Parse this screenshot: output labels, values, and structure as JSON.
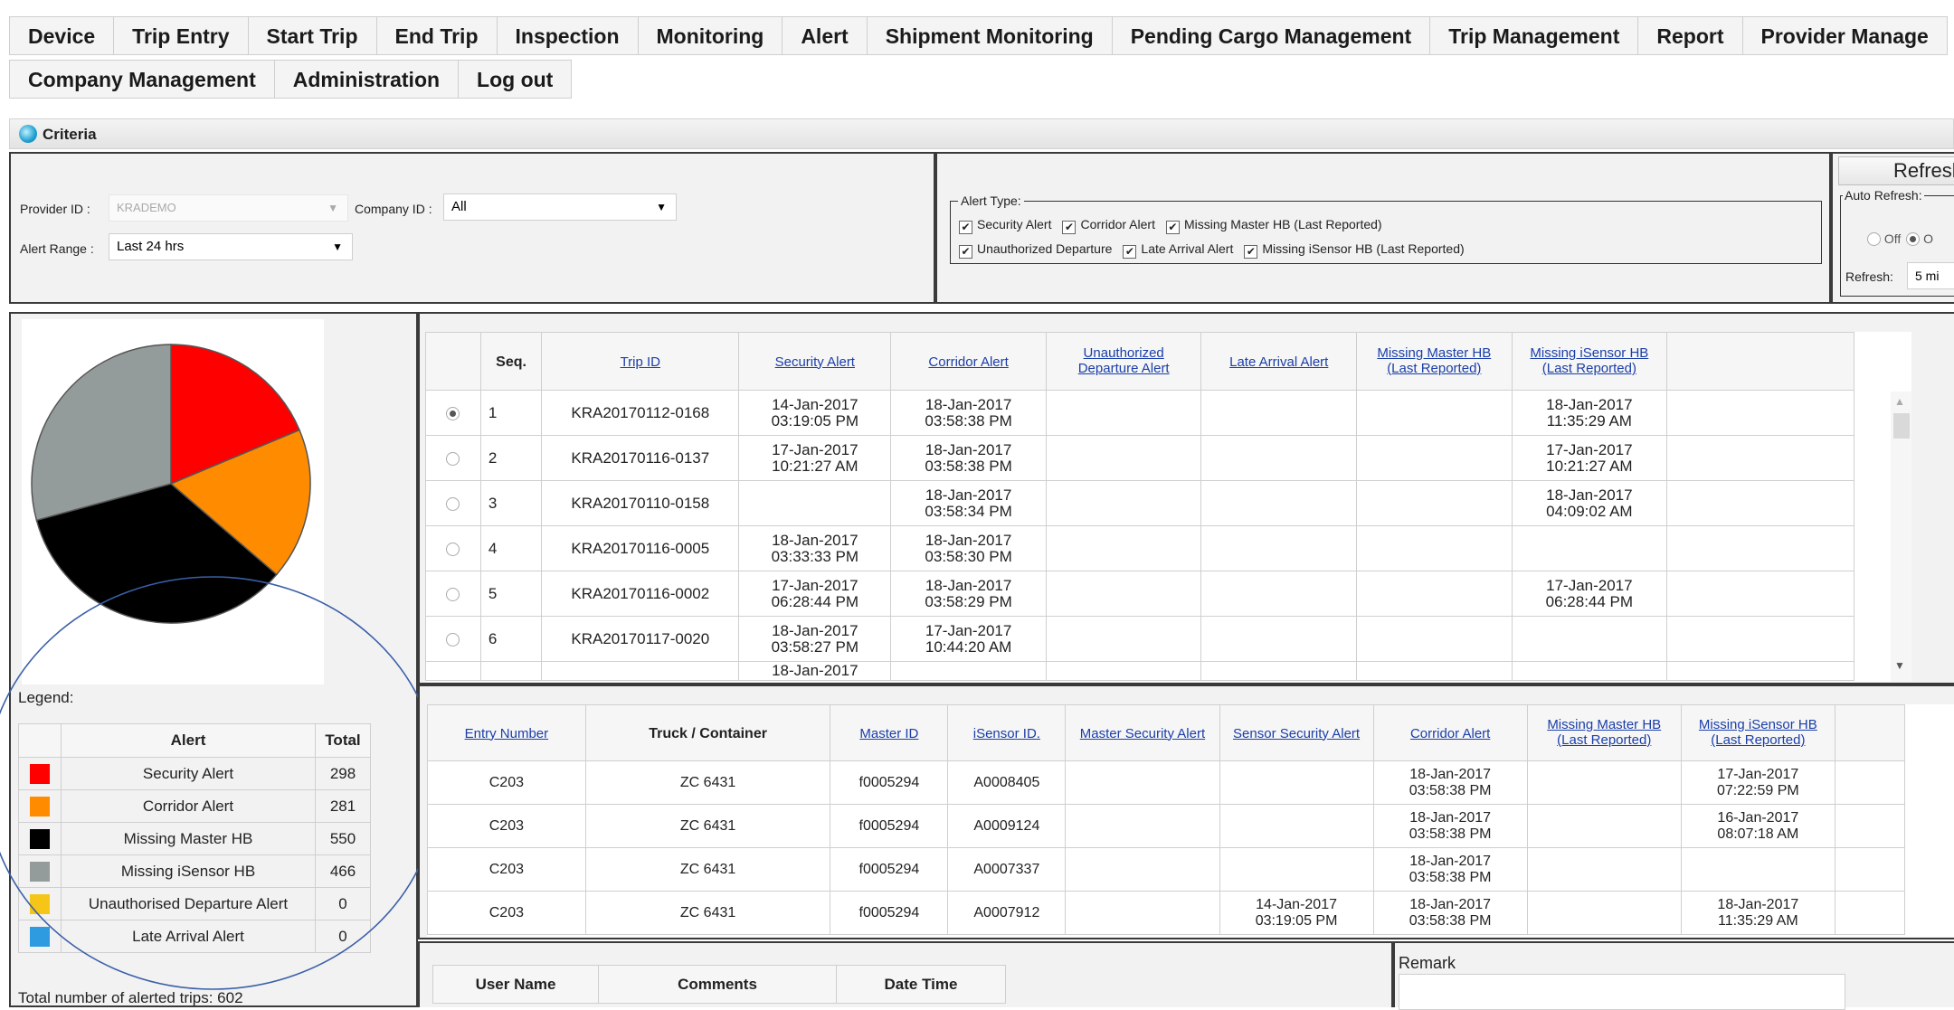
{
  "nav": {
    "row1": [
      "Device",
      "Trip Entry",
      "Start Trip",
      "End Trip",
      "Inspection",
      "Monitoring",
      "Alert",
      "Shipment Monitoring",
      "Pending Cargo Management",
      "Trip Management",
      "Report",
      "Provider Manage"
    ],
    "row2": [
      "Company Management",
      "Administration",
      "Log out"
    ]
  },
  "criteria": {
    "title": "Criteria",
    "provider_label": "Provider ID :",
    "provider_value": "KRADEMO",
    "company_label": "Company ID :",
    "company_value": "All",
    "range_label": "Alert Range :",
    "range_value": "Last 24 hrs",
    "alert_type_legend": "Alert Type:",
    "alert_types_row1": [
      "Security Alert",
      "Corridor Alert",
      "Missing Master HB (Last Reported)"
    ],
    "alert_types_row2": [
      "Unauthorized Departure",
      "Late Arrival Alert",
      "Missing iSensor HB (Last Reported)"
    ],
    "refresh_button": "Refresh",
    "auto_refresh_legend": "Auto Refresh:",
    "off_label": "Off",
    "on_label": "O",
    "refresh_label": "Refresh:",
    "refresh_value": "5 mi"
  },
  "chart_data": {
    "type": "pie",
    "categories": [
      "Security Alert",
      "Corridor Alert",
      "Missing Master HB",
      "Missing iSensor HB",
      "Unauthorised Departure Alert",
      "Late Arrival Alert"
    ],
    "values": [
      298,
      281,
      550,
      466,
      0,
      0
    ],
    "colors": [
      "#ff0000",
      "#ff8c00",
      "#000000",
      "#949c9b",
      "#f5c518",
      "#2e9be0"
    ]
  },
  "legend": {
    "title": "Legend:",
    "col_alert": "Alert",
    "col_total": "Total",
    "rows": [
      {
        "name": "Security Alert",
        "total": "298",
        "color": "#ff0000"
      },
      {
        "name": "Corridor Alert",
        "total": "281",
        "color": "#ff8c00"
      },
      {
        "name": "Missing Master HB",
        "total": "550",
        "color": "#000000"
      },
      {
        "name": "Missing iSensor HB",
        "total": "466",
        "color": "#949c9b"
      },
      {
        "name": "Unauthorised Departure Alert",
        "total": "0",
        "color": "#f5c518"
      },
      {
        "name": "Late Arrival Alert",
        "total": "0",
        "color": "#2e9be0"
      }
    ],
    "total_text": "Total number of alerted trips: 602"
  },
  "trips": {
    "headers": [
      "Seq.",
      "Trip ID",
      "Security Alert",
      "Corridor Alert",
      "Unauthorized Departure Alert",
      "Late Arrival Alert",
      "Missing Master HB (Last Reported)",
      "Missing iSensor HB (Last Reported)"
    ],
    "rows": [
      {
        "seq": "1",
        "trip": "KRA20170112-0168",
        "security": "14-Jan-2017 03:19:05 PM",
        "corridor": "18-Jan-2017 03:58:38 PM",
        "unauth": "",
        "late": "",
        "master": "",
        "isensor": "18-Jan-2017 11:35:29 AM",
        "selected": true
      },
      {
        "seq": "2",
        "trip": "KRA20170116-0137",
        "security": "17-Jan-2017 10:21:27 AM",
        "corridor": "18-Jan-2017 03:58:38 PM",
        "unauth": "",
        "late": "",
        "master": "",
        "isensor": "17-Jan-2017 10:21:27 AM",
        "selected": false
      },
      {
        "seq": "3",
        "trip": "KRA20170110-0158",
        "security": "",
        "corridor": "18-Jan-2017 03:58:34 PM",
        "unauth": "",
        "late": "",
        "master": "",
        "isensor": "18-Jan-2017 04:09:02 AM",
        "selected": false
      },
      {
        "seq": "4",
        "trip": "KRA20170116-0005",
        "security": "18-Jan-2017 03:33:33 PM",
        "corridor": "18-Jan-2017 03:58:30 PM",
        "unauth": "",
        "late": "",
        "master": "",
        "isensor": "",
        "selected": false
      },
      {
        "seq": "5",
        "trip": "KRA20170116-0002",
        "security": "17-Jan-2017 06:28:44 PM",
        "corridor": "18-Jan-2017 03:58:29 PM",
        "unauth": "",
        "late": "",
        "master": "",
        "isensor": "17-Jan-2017 06:28:44 PM",
        "selected": false
      },
      {
        "seq": "6",
        "trip": "KRA20170117-0020",
        "security": "18-Jan-2017 03:58:27 PM",
        "corridor": "17-Jan-2017 10:44:20 AM",
        "unauth": "",
        "late": "",
        "master": "",
        "isensor": "",
        "selected": false
      }
    ],
    "partial_text": "18-Jan-2017"
  },
  "entries": {
    "headers": [
      "Entry Number",
      "Truck / Container",
      "Master ID",
      "iSensor ID.",
      "Master Security Alert",
      "Sensor Security Alert",
      "Corridor Alert",
      "Missing Master HB (Last Reported)",
      "Missing iSensor HB (Last Reported)"
    ],
    "rows": [
      {
        "entry": "C203",
        "truck": "ZC 6431",
        "master": "f0005294",
        "sensor": "A0008405",
        "msec": "",
        "ssec": "",
        "corridor": "18-Jan-2017 03:58:38 PM",
        "mhb": "",
        "ihb": "17-Jan-2017 07:22:59 PM"
      },
      {
        "entry": "C203",
        "truck": "ZC 6431",
        "master": "f0005294",
        "sensor": "A0009124",
        "msec": "",
        "ssec": "",
        "corridor": "18-Jan-2017 03:58:38 PM",
        "mhb": "",
        "ihb": "16-Jan-2017 08:07:18 AM"
      },
      {
        "entry": "C203",
        "truck": "ZC 6431",
        "master": "f0005294",
        "sensor": "A0007337",
        "msec": "",
        "ssec": "",
        "corridor": "18-Jan-2017 03:58:38 PM",
        "mhb": "",
        "ihb": ""
      },
      {
        "entry": "C203",
        "truck": "ZC 6431",
        "master": "f0005294",
        "sensor": "A0007912",
        "msec": "",
        "ssec": "14-Jan-2017 03:19:05 PM",
        "corridor": "18-Jan-2017 03:58:38 PM",
        "mhb": "",
        "ihb": "18-Jan-2017 11:35:29 AM"
      }
    ]
  },
  "comments": {
    "headers": [
      "User Name",
      "Comments",
      "Date Time"
    ],
    "remark_label": "Remark"
  }
}
